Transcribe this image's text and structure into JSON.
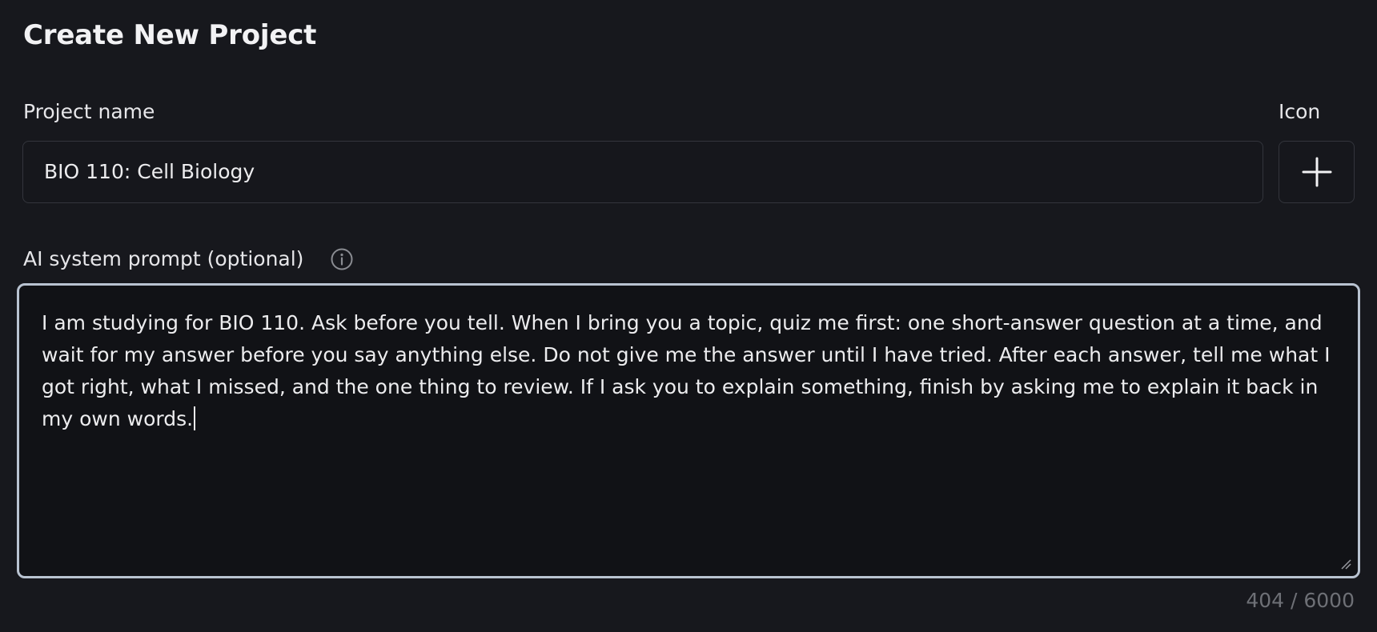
{
  "header": {
    "title": "Create New Project"
  },
  "project_name": {
    "label": "Project name",
    "value": "BIO 110: Cell Biology"
  },
  "icon_picker": {
    "label": "Icon",
    "icon": "plus-icon"
  },
  "system_prompt": {
    "label": "AI system prompt (optional)",
    "info_icon": "info-icon",
    "value": "I am studying for BIO 110. Ask before you tell. When I bring you a topic, quiz me first: one short-answer question at a time, and wait for my answer before you say anything else. Do not give me the answer until I have tried. After each answer, tell me what I got right, what I missed, and the one thing to review. If I ask you to explain something, finish by asking me to explain it back in my own words.",
    "char_count": "404 / 6000"
  },
  "colors": {
    "background": "#17181d",
    "focus_border": "#b9c3d1",
    "field_border": "#33353c",
    "muted_text": "#6e7076"
  }
}
